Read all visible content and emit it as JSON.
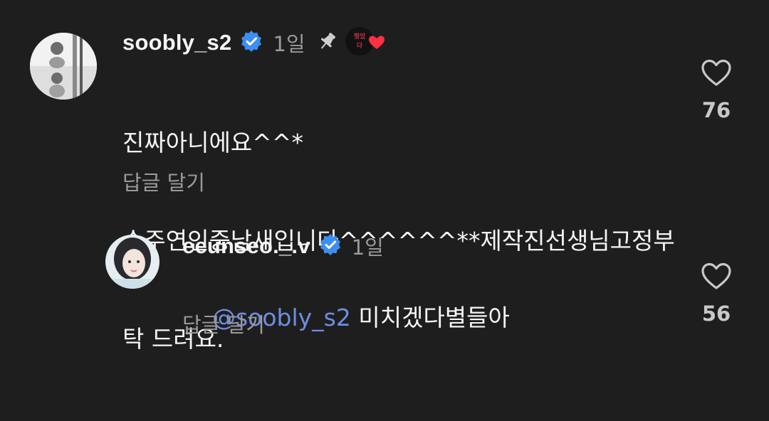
{
  "comments": [
    {
      "username": "soobly_s2",
      "time": "1일",
      "text_lines": [
        "진짜아니에요^^*",
        "손주연인중남새입니다^^^^^^**제작진선생님고정부",
        "탁 드려요."
      ],
      "reply_label": "답글 달기",
      "likes": "76",
      "pinned": true,
      "sticker_text": "찢었다"
    },
    {
      "username": "eeunseo._.v",
      "time": "1일",
      "mention": "@soobly_s2",
      "text": " 미치겠다별들아",
      "reply_label": "답글 달기",
      "likes": "56"
    }
  ],
  "colors": {
    "background": "#1e1e1e",
    "verified": "#3d8ef0",
    "secondary_text": "#9a9a9a",
    "mention": "#6f8ee0",
    "heart_red": "#ff3040"
  },
  "icons": {
    "verified": "verified-badge-icon",
    "pin": "pin-icon",
    "like": "heart-outline-icon",
    "mention": "threads-at-icon"
  }
}
